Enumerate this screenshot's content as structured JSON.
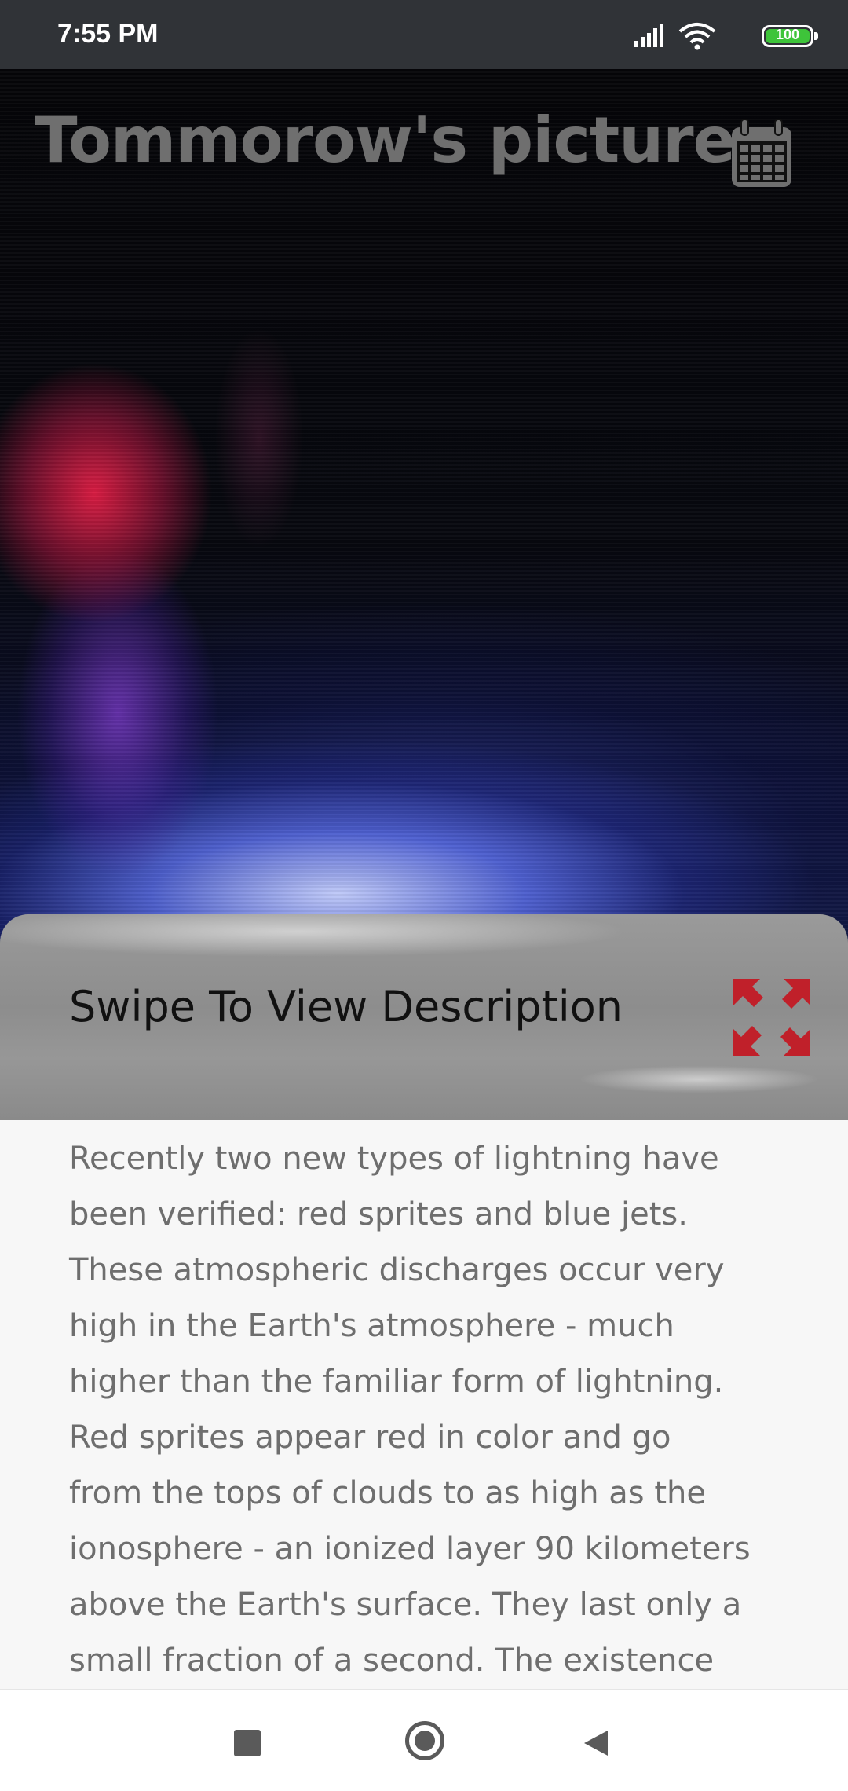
{
  "status_bar": {
    "time": "7:55 PM",
    "battery": "100",
    "icons": [
      "signal-icon",
      "wifi-icon",
      "battery-icon"
    ]
  },
  "header": {
    "title": "Tommorow's picture",
    "calendar_icon": "calendar-icon"
  },
  "swipe_panel": {
    "label": "Swipe To View Description",
    "expand_icon": "expand-icon",
    "accent_color": "#c0202a"
  },
  "description": {
    "lines": [
      "Recently two new types of lightning have",
      "been verified: red sprites and blue jets.",
      "These atmospheric discharges occur very",
      "high in the Earth's atmosphere - much",
      "higher than the familiar form of lightning.",
      "Red sprites appear red in color and go",
      "from the tops of clouds to as high as the",
      "ionosphere - an ionized layer 90 kilometers",
      "above the Earth's surface. They last only a",
      "small fraction of a second.  The existence"
    ]
  },
  "nav_bar": {
    "icons": [
      "recent-apps-icon",
      "home-icon",
      "back-icon"
    ]
  }
}
